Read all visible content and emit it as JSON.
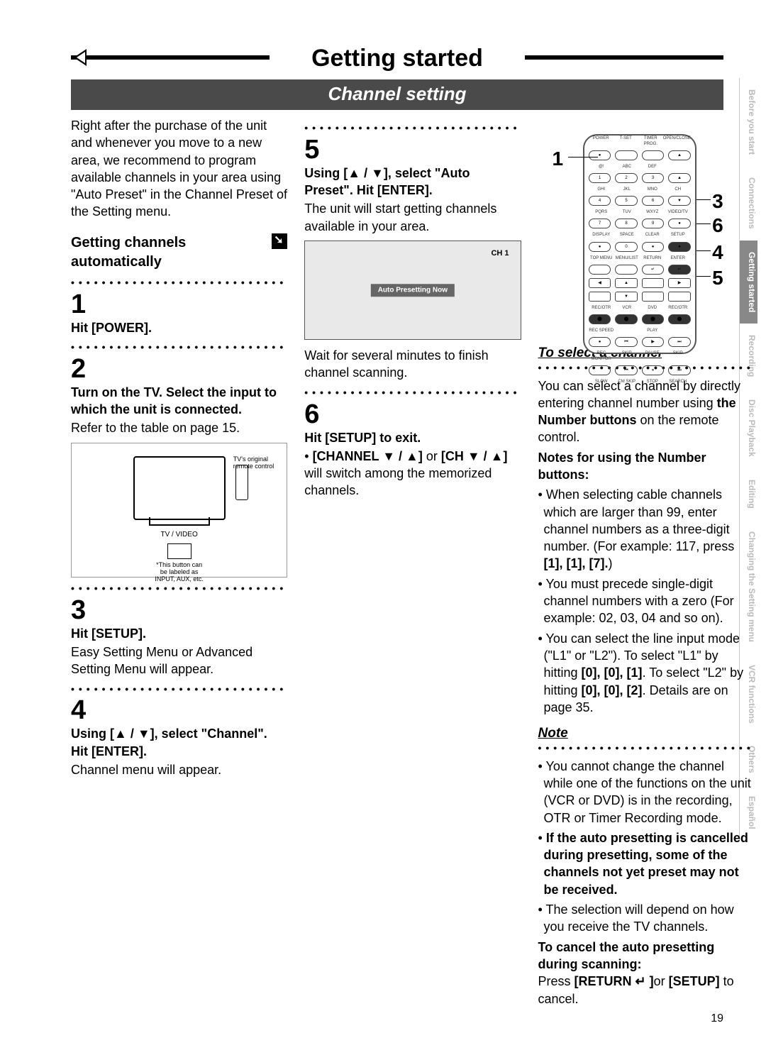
{
  "header": {
    "title": "Getting started"
  },
  "section": {
    "title": "Channel setting"
  },
  "page_number": "19",
  "intro": "Right after the purchase of the unit and whenever you move to a new area, we recommend to program available channels in your area using \"Auto Preset\" in the Channel Preset of the Setting menu.",
  "autosub": {
    "title": "Getting channels automatically"
  },
  "steps": {
    "s1": {
      "num": "1",
      "head": "Hit [POWER]."
    },
    "s2": {
      "num": "2",
      "head": "Turn on the TV. Select the input to which the unit is connected.",
      "body": "Refer to the table on page 15."
    },
    "tv": {
      "lbl1a": "TV's original",
      "lbl1b": "remote control",
      "lbl2": "TV / VIDEO",
      "note1": "*This button can",
      "note2": "be labeled as",
      "note3": "INPUT, AUX, etc."
    },
    "s3": {
      "num": "3",
      "head": "Hit [SETUP].",
      "body": "Easy Setting Menu or Advanced Setting Menu will appear."
    },
    "s4": {
      "num": "4",
      "head": "Using [▲ / ▼], select \"Channel\". Hit [ENTER].",
      "body": "Channel menu will appear."
    },
    "s5": {
      "num": "5",
      "head": "Using [▲ / ▼], select \"Auto Preset\". Hit [ENTER].",
      "body": "The unit will start getting channels available in your area."
    },
    "osd": {
      "ch": "CH 1",
      "msg": "Auto Presetting Now"
    },
    "s5b": "Wait for several minutes to finish channel scanning.",
    "s6": {
      "num": "6",
      "head": "Hit [SETUP] to exit.",
      "bullet_pre": "• ",
      "bullet_b1": "[CHANNEL ▼ / ▲]",
      "bullet_mid": " or ",
      "bullet_b2": "[CH ▼ / ▲]",
      "bullet_tail": " will switch among the memorized channels."
    }
  },
  "callouts": {
    "c1": "1",
    "c3": "3",
    "c4": "4",
    "c5": "5",
    "c6": "6"
  },
  "remote": {
    "row_labels": [
      [
        "POWER",
        "T-SET",
        "TIMER PROG.",
        "OPEN/CLOSE"
      ],
      [
        "@!",
        "ABC",
        "DEF",
        ""
      ],
      [
        "GHI",
        "JKL",
        "MNO",
        "CH"
      ],
      [
        "PQRS",
        "TUV",
        "WXYZ",
        "VIDEO/TV"
      ],
      [
        "DISPLAY",
        "SPACE",
        "CLEAR",
        "SETUP"
      ],
      [
        "TOP MENU",
        "MENU/LIST",
        "RETURN",
        "ENTER"
      ],
      [
        "REC/OTR",
        "VCR",
        "DVD",
        "REC/OTR"
      ],
      [
        "REC SPEED",
        "",
        "PLAY",
        ""
      ],
      [
        "REC MONITOR",
        "SKIP",
        "PAUSE",
        "SKIP"
      ],
      [
        "SLOW",
        "CM SKIP",
        "STOP",
        "SEARCH"
      ]
    ]
  },
  "select": {
    "head": "To select a channel",
    "intro_1": "You can select a channel by directly entering channel number using ",
    "intro_b": "the Number buttons",
    "intro_2": " on the remote control.",
    "noteh": "Notes for using the Number buttons:",
    "b1_1": "When selecting cable channels which are larger than 99, enter channel numbers as a three-digit number. (For example: 117, press ",
    "b1_k": "[1], [1], [7].",
    "b1_2": ")",
    "b2": "You must precede single-digit channel numbers with a zero (For example: 02, 03, 04 and so on).",
    "b3_1": "You can select the line input mode (\"L1\" or \"L2\"). To select \"L1\" by hitting ",
    "b3_k1": "[0], [0], [1]",
    "b3_2": ". To select \"L2\" by hitting ",
    "b3_k2": "[0], [0], [2]",
    "b3_3": ". Details are on page 35."
  },
  "note": {
    "head": "Note",
    "n1": "You cannot change the channel while one of the functions on the unit (VCR or DVD) is in the recording, OTR or Timer Recording mode.",
    "n2": "If the auto presetting is cancelled during presetting, some of the channels not yet preset may not be received.",
    "n3": "The selection will depend on how you receive the TV channels.",
    "n4h": "To cancel the auto presetting during scanning:",
    "n4_1": "Press ",
    "n4_k1": "[RETURN ↵ ]",
    "n4_2": "or ",
    "n4_k2": "[SETUP]",
    "n4_3": " to cancel."
  },
  "tabs": [
    "Before you start",
    "Connections",
    "Getting started",
    "Recording",
    "Disc Playback",
    "Editing",
    "Changing the Setting menu",
    "VCR functions",
    "Others",
    "Español"
  ],
  "active_tab_index": 2
}
